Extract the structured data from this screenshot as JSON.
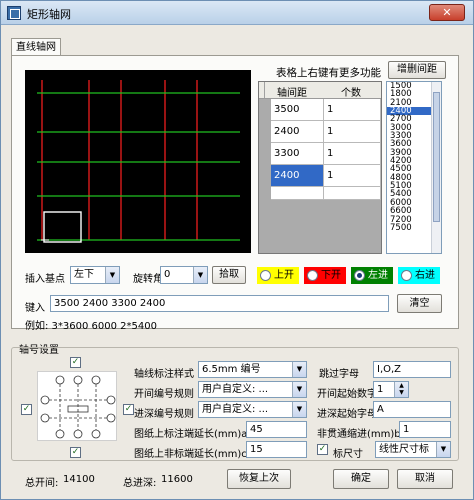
{
  "window": {
    "title": "矩形轴网",
    "close_glyph": "✕"
  },
  "tab": {
    "label": "直线轴网"
  },
  "table_hint": "表格上右键有更多功能",
  "add_spacing_button": "增删间距",
  "spacing_table": {
    "headers": [
      "轴间距",
      "个数"
    ],
    "rows": [
      {
        "spacing": "3500",
        "count": "1"
      },
      {
        "spacing": "2400",
        "count": "1"
      },
      {
        "spacing": "3300",
        "count": "1"
      },
      {
        "spacing": "2400",
        "count": "1"
      }
    ]
  },
  "spacing_list": [
    "1500",
    "1800",
    "2100",
    "2400",
    "2700",
    "3000",
    "3300",
    "3600",
    "3900",
    "4200",
    "4500",
    "4800",
    "5100",
    "5400",
    "6000",
    "6600",
    "7200",
    "7500"
  ],
  "spacing_list_selected": "2400",
  "insert_point": {
    "label": "插入基点",
    "value": "左下"
  },
  "rotation": {
    "label": "旋转角度",
    "value": "0",
    "pick_button": "拾取"
  },
  "direction_options": [
    {
      "label": "上开",
      "color": "#ffff00",
      "selected": false
    },
    {
      "label": "下开",
      "color": "#ff0000",
      "selected": false
    },
    {
      "label": "左进",
      "color": "#008000",
      "selected": true
    },
    {
      "label": "右进",
      "color": "#00ffff",
      "selected": false
    }
  ],
  "input": {
    "label": "键入",
    "value": "3500 2400 3300 2400",
    "clear_button": "清空"
  },
  "example": "例如: 3*3600 6000 2*5400",
  "axis_settings": {
    "group_label": "轴号设置",
    "style_label": "轴线标注样式",
    "style_value": "6.5mm 编号",
    "skip_label": "跳过字母",
    "skip_value": "I,O,Z",
    "open_rule_label": "开间编号规则",
    "open_rule_value": "用户自定义: ...",
    "open_start_label": "开间起始数字",
    "open_start_value": "1",
    "depth_rule_label": "进深编号规则",
    "depth_rule_value": "用户自定义: ...",
    "depth_start_label": "进深起始字母",
    "depth_start_value": "A",
    "upper_ext_label": "图纸上标注端延长(mm)a=",
    "upper_ext_value": "45",
    "nonpass_label": "非贯通缩进(mm)b=",
    "nonpass_value": "1",
    "lower_ext_label": "图纸上非标端延长(mm)c=",
    "lower_ext_value": "15",
    "dim_check_label": "标尺寸",
    "dim_style_value": "线性尺寸标"
  },
  "footer": {
    "total_open_label": "总开间:",
    "total_open_value": "14100",
    "total_depth_label": "总进深:",
    "total_depth_value": "11600",
    "restore_button": "恢复上次",
    "ok_button": "确定",
    "cancel_button": "取消"
  },
  "colors": {
    "grid_red": "#ff0000",
    "grid_green": "#00b000",
    "selection_blue": "#3169c6"
  }
}
